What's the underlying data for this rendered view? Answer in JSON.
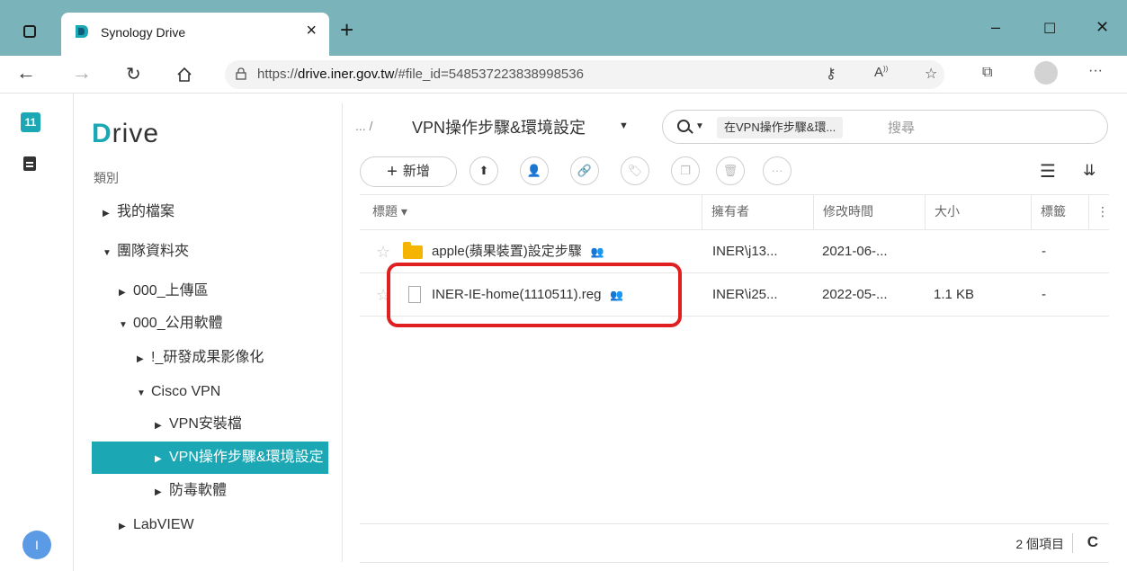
{
  "browser": {
    "tab_title": "Synology Drive",
    "tab_close": "×",
    "new_tab": "+",
    "url_prefix": "https://",
    "url_host": "drive.iner.gov.tw",
    "url_path": "/#file_id=548537223838998536",
    "win_min": "–",
    "win_max": "☐",
    "win_close": "✕",
    "more": "···"
  },
  "rail": {
    "badge": "11",
    "avatar_initial": "I"
  },
  "sidebar": {
    "logo_first": "D",
    "logo_rest": "rive",
    "category_label": "類別",
    "items": [
      {
        "label": "我的檔案",
        "arrow": "▶"
      },
      {
        "label": "團隊資料夾",
        "arrow": "▼"
      },
      {
        "label": "000_上傳區",
        "arrow": "▶"
      },
      {
        "label": "000_公用軟體",
        "arrow": "▼"
      },
      {
        "label": "!_研發成果影像化",
        "arrow": "▶"
      },
      {
        "label": "Cisco VPN",
        "arrow": "▼"
      },
      {
        "label": "VPN安裝檔",
        "arrow": "▶"
      },
      {
        "label": "VPN操作步驟&環境設定",
        "arrow": "▶"
      },
      {
        "label": "防毒軟體",
        "arrow": "▶"
      },
      {
        "label": "LabVIEW",
        "arrow": "▶"
      }
    ]
  },
  "main": {
    "breadcrumb_dots": "... /",
    "breadcrumb_title": "VPN操作步驟&環境設定",
    "search_scope": "在VPN操作步驟&環...",
    "search_placeholder": "搜尋",
    "new_button": "新增",
    "columns": [
      "標題 ▾",
      "擁有者",
      "修改時間",
      "大小",
      "標籤",
      "⋮"
    ],
    "rows": [
      {
        "title": "apple(蘋果裝置)設定步驟",
        "owner": "INER\\j13...",
        "modified": "2021-06-...",
        "size": "",
        "tags": "-",
        "type": "folder"
      },
      {
        "title": "INER-IE-home(1110511).reg",
        "owner": "INER\\i25...",
        "modified": "2022-05-...",
        "size": "1.1 KB",
        "tags": "-",
        "type": "file"
      }
    ],
    "item_count": "2 個項目",
    "refresh": "C"
  }
}
